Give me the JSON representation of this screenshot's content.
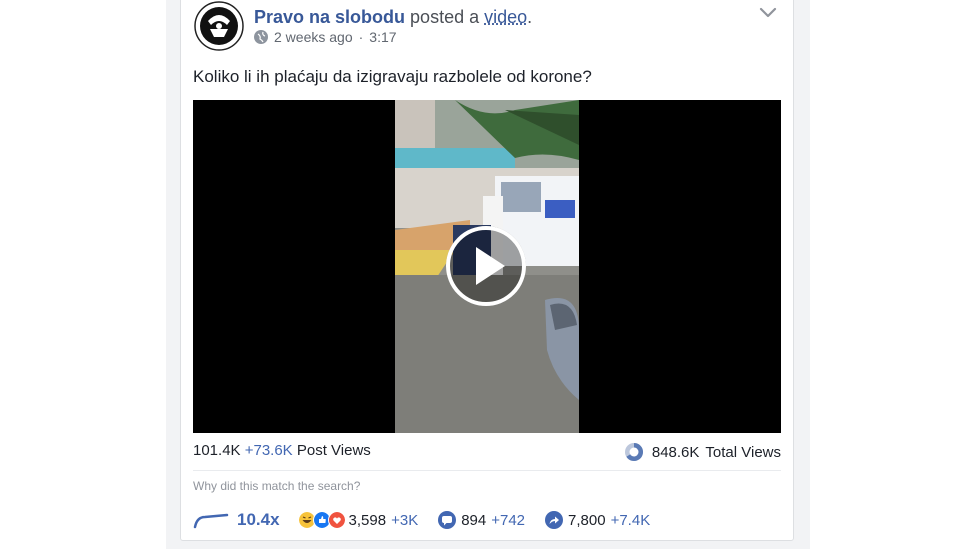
{
  "post": {
    "page_name": "Pravo na slobodu",
    "action_text": "posted a",
    "object_link": "video",
    "period": ".",
    "time_ago": "2 weeks ago",
    "separator": "·",
    "duration": "3:17",
    "message": "Koliko li ih plaćaju da izigravaju razbolele od korone?"
  },
  "stats": {
    "post_views": "101.4K",
    "post_views_delta": "+73.6K",
    "post_views_label": "Post Views",
    "total_views": "848.6K",
    "total_views_label": "Total Views"
  },
  "search_hint": "Why did this match the search?",
  "engagement": {
    "overperforming": "10.4x",
    "reactions": "3,598",
    "reactions_delta": "+3K",
    "comments": "894",
    "comments_delta": "+742",
    "shares": "7,800",
    "shares_delta": "+7.4K"
  },
  "colors": {
    "link_blue": "#385898",
    "accent_blue": "#4267b2",
    "muted": "#616770"
  },
  "icons": [
    "avatar-logo",
    "globe-icon",
    "chevron-down-icon",
    "play-icon",
    "views-ring-icon",
    "trend-line-icon",
    "haha-icon",
    "like-icon",
    "love-icon",
    "comment-icon",
    "share-icon"
  ]
}
